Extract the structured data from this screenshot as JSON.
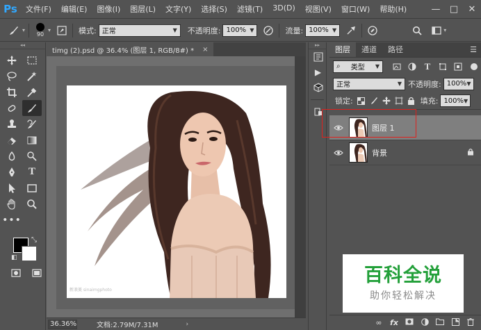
{
  "app": {
    "logo": "Ps"
  },
  "menu": [
    "文件(F)",
    "编辑(E)",
    "图像(I)",
    "图层(L)",
    "文字(Y)",
    "选择(S)",
    "滤镜(T)",
    "3D(D)",
    "视图(V)",
    "窗口(W)",
    "帮助(H)"
  ],
  "window_controls": {
    "minimize": "—",
    "maximize": "□",
    "close": "✕"
  },
  "options": {
    "brush_size": "90",
    "mode_label": "模式:",
    "mode_value": "正常",
    "opacity_label": "不透明度:",
    "opacity_value": "100%",
    "flow_label": "流量:",
    "flow_value": "100%"
  },
  "document": {
    "tab_title": "timg (2).psd @ 36.4% (图层 1, RGB/8#) *",
    "tab_close": "×",
    "zoom": "36.36%",
    "doc_info": "文档:2.79M/7.31M",
    "canvas_watermark": "新浪美 sinaimgphoto"
  },
  "layers_panel": {
    "tabs": [
      "图层",
      "通道",
      "路径"
    ],
    "filter_label": "类型",
    "blend_mode": "正常",
    "opacity_label": "不透明度:",
    "opacity_value": "100%",
    "lock_label": "锁定:",
    "fill_label": "填充:",
    "fill_value": "100%",
    "layers": [
      {
        "name": "图层 1",
        "selected": true
      },
      {
        "name": "背景",
        "locked": true
      }
    ],
    "footer_icons": [
      "link-icon",
      "fx-icon",
      "mask-icon",
      "adjustment-icon",
      "group-icon",
      "new-layer-icon",
      "trash-icon"
    ]
  },
  "overlay_watermark": {
    "title": "百科全说",
    "subtitle": "助你轻松解决"
  },
  "colors": {
    "highlight": "#e0201c",
    "watermark_green": "#23a03a",
    "ps_blue": "#31a8ff"
  }
}
